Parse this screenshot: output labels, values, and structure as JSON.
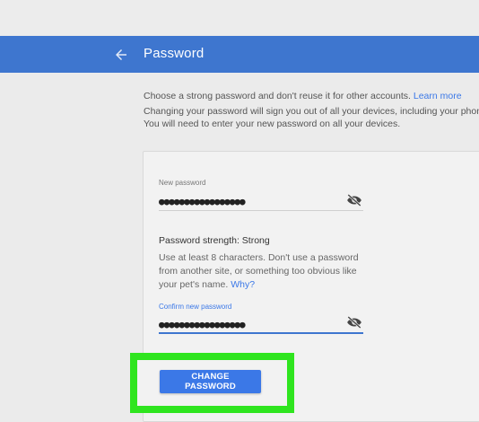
{
  "header": {
    "title": "Password",
    "back_icon": "arrow-back-icon",
    "bar_color": "#3e76cf"
  },
  "intro": {
    "line1": "Choose a strong password and don't reuse it for other accounts.",
    "learn_more": "Learn more",
    "line2": "Changing your password will sign you out of all your devices, including your phone. You will need to enter your new password on all your devices."
  },
  "form": {
    "new_password": {
      "label": "New password",
      "value": "●●●●●●●●●●●●●●●●●",
      "toggle_icon": "eye-off-icon"
    },
    "strength": {
      "label": "Password strength: ",
      "value": "Strong"
    },
    "hint": {
      "text": "Use at least 8 characters. Don't use a password from another site, or something too obvious like your pet's name.",
      "why_link": "Why?"
    },
    "confirm_password": {
      "label": "Confirm new password",
      "value": "●●●●●●●●●●●●●●●●●",
      "toggle_icon": "eye-off-icon"
    },
    "submit_label": "CHANGE PASSWORD"
  },
  "annotation": {
    "highlight_color": "#2fe51f"
  }
}
